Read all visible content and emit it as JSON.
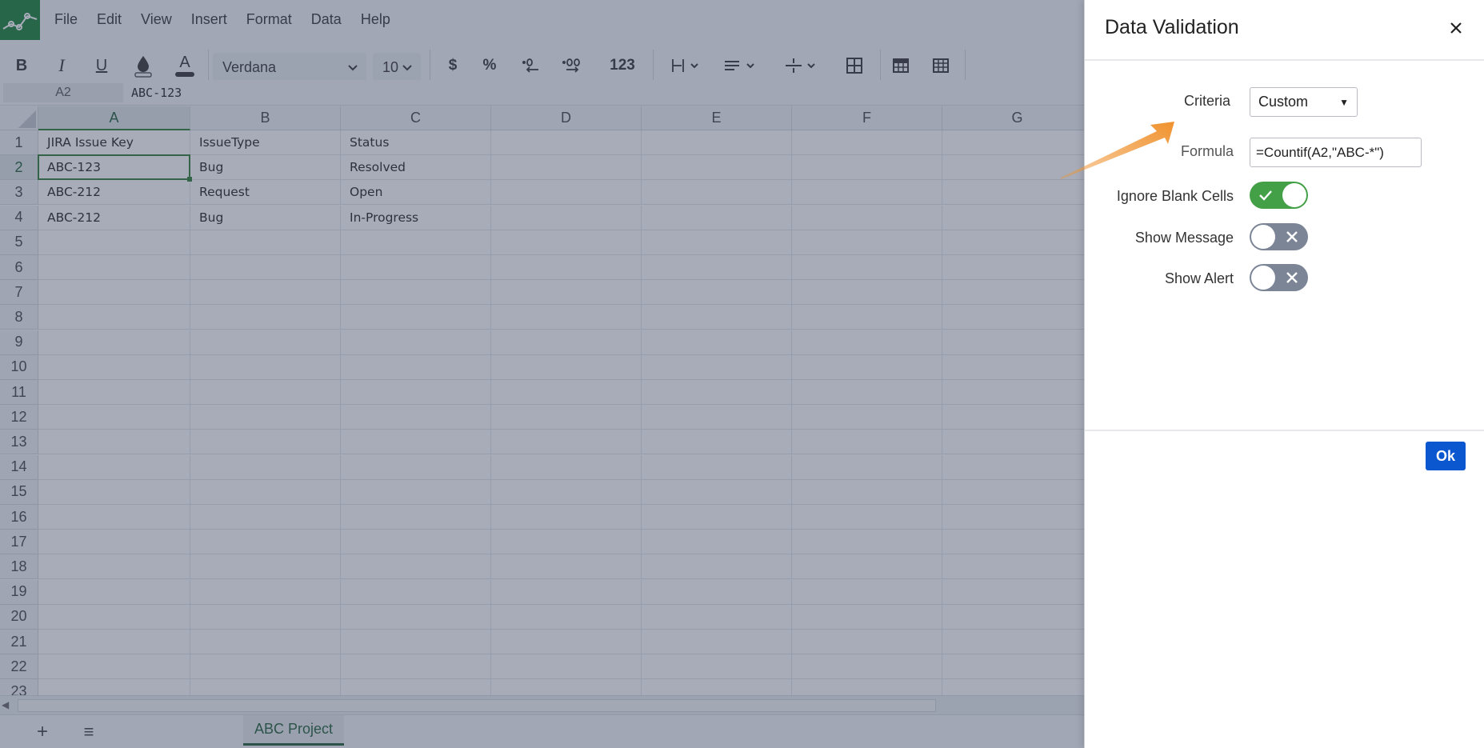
{
  "menubar": {
    "items": [
      "File",
      "Edit",
      "View",
      "Insert",
      "Format",
      "Data",
      "Help"
    ]
  },
  "toolbar": {
    "bold_label": "B",
    "italic_label": "I",
    "underline_label": "U",
    "text_color_label": "A",
    "font_family": "Verdana",
    "font_size": "10",
    "currency_label": "$",
    "percent_label": "%",
    "number_format_label": "123"
  },
  "formula_bar": {
    "cell_ref": "A2",
    "value": "ABC-123"
  },
  "grid": {
    "columns": [
      "A",
      "B",
      "C",
      "D",
      "E",
      "F",
      "G"
    ],
    "active_column": "A",
    "active_row": "2",
    "rows": [
      "1",
      "2",
      "3",
      "4",
      "5",
      "6",
      "7",
      "8",
      "9",
      "10",
      "11",
      "12",
      "13",
      "14",
      "15",
      "16",
      "17",
      "18",
      "19",
      "20",
      "21",
      "22",
      "23"
    ],
    "cells": [
      [
        "JIRA Issue Key",
        "IssueType",
        "Status"
      ],
      [
        "ABC-123",
        "Bug",
        "Resolved"
      ],
      [
        "ABC-212",
        "Request",
        "Open"
      ],
      [
        "ABC-212",
        "Bug",
        "In-Progress"
      ]
    ]
  },
  "sheets": {
    "add_label": "+",
    "list_label": "≡",
    "active_tab": "ABC Project"
  },
  "dialog": {
    "title": "Data Validation",
    "criteria_label": "Criteria",
    "criteria_value": "Custom",
    "formula_label": "Formula",
    "formula_value": "=Countif(A2,\"ABC-*\")",
    "ignore_blank_label": "Ignore Blank Cells",
    "ignore_blank_on": true,
    "show_message_label": "Show Message",
    "show_message_on": false,
    "show_alert_label": "Show Alert",
    "show_alert_on": false,
    "ok_label": "Ok"
  },
  "colors": {
    "brand_green": "#188038",
    "selection_green": "#2e7d32",
    "toggle_on": "#43a047",
    "toggle_off": "#7b8596",
    "ok_button": "#0b57d0",
    "annotation_arrow": "#f0922e"
  },
  "icons": {
    "logo": "spreadsheet-logo-icon",
    "close": "close-icon",
    "check": "check-icon",
    "cross": "cross-icon",
    "dropdown": "chevron-down-icon"
  }
}
